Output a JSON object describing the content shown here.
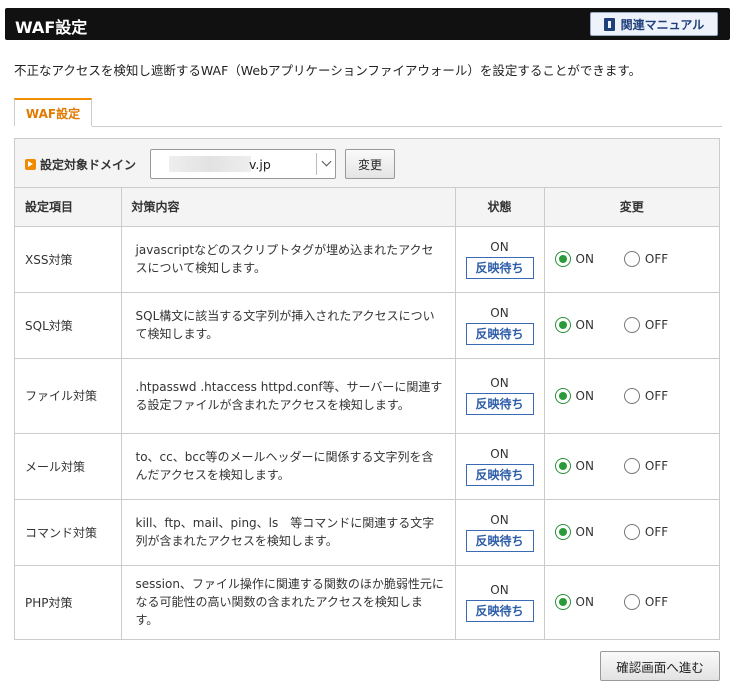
{
  "header": {
    "title": "WAF設定",
    "manual_label": "関連マニュアル"
  },
  "description": "不正なアクセスを検知し遮断するWAF（Webアプリケーションファイアウォール）を設定することができます。",
  "tab": {
    "label": "WAF設定"
  },
  "domain": {
    "label": "設定対象ドメイン",
    "selected_value": "v.jp",
    "change_label": "変更"
  },
  "table": {
    "headers": {
      "item": "設定項目",
      "content": "対策内容",
      "status": "状態",
      "change": "変更"
    },
    "rows": [
      {
        "item": "XSS対策",
        "content": "javascriptなどのスクリプトタグが埋め込まれたアクセスについて検知します。",
        "status": "ON",
        "pending": "反映待ち",
        "on": "ON",
        "off": "OFF",
        "selected": "ON"
      },
      {
        "item": "SQL対策",
        "content": "SQL構文に該当する文字列が挿入されたアクセスについて検知します。",
        "status": "ON",
        "pending": "反映待ち",
        "on": "ON",
        "off": "OFF",
        "selected": "ON"
      },
      {
        "item": "ファイル対策",
        "content": ".htpasswd .htaccess httpd.conf等、サーバーに関連する設定ファイルが含まれたアクセスを検知します。",
        "status": "ON",
        "pending": "反映待ち",
        "on": "ON",
        "off": "OFF",
        "selected": "ON"
      },
      {
        "item": "メール対策",
        "content": "to、cc、bcc等のメールヘッダーに関係する文字列を含んだアクセスを検知します。",
        "status": "ON",
        "pending": "反映待ち",
        "on": "ON",
        "off": "OFF",
        "selected": "ON"
      },
      {
        "item": "コマンド対策",
        "content": "kill、ftp、mail、ping、ls　等コマンドに関連する文字列が含まれたアクセスを検知します。",
        "status": "ON",
        "pending": "反映待ち",
        "on": "ON",
        "off": "OFF",
        "selected": "ON"
      },
      {
        "item": "PHP対策",
        "content": "session、ファイル操作に関連する関数のほか脆弱性元になる可能性の高い関数の含まれたアクセスを検知します。",
        "status": "ON",
        "pending": "反映待ち",
        "on": "ON",
        "off": "OFF",
        "selected": "ON"
      }
    ]
  },
  "footer": {
    "confirm_label": "確認画面へ進む"
  },
  "colors": {
    "accent_orange": "#f28c00",
    "radio_green": "#2a9a3a",
    "link_blue": "#2d5ca8"
  }
}
